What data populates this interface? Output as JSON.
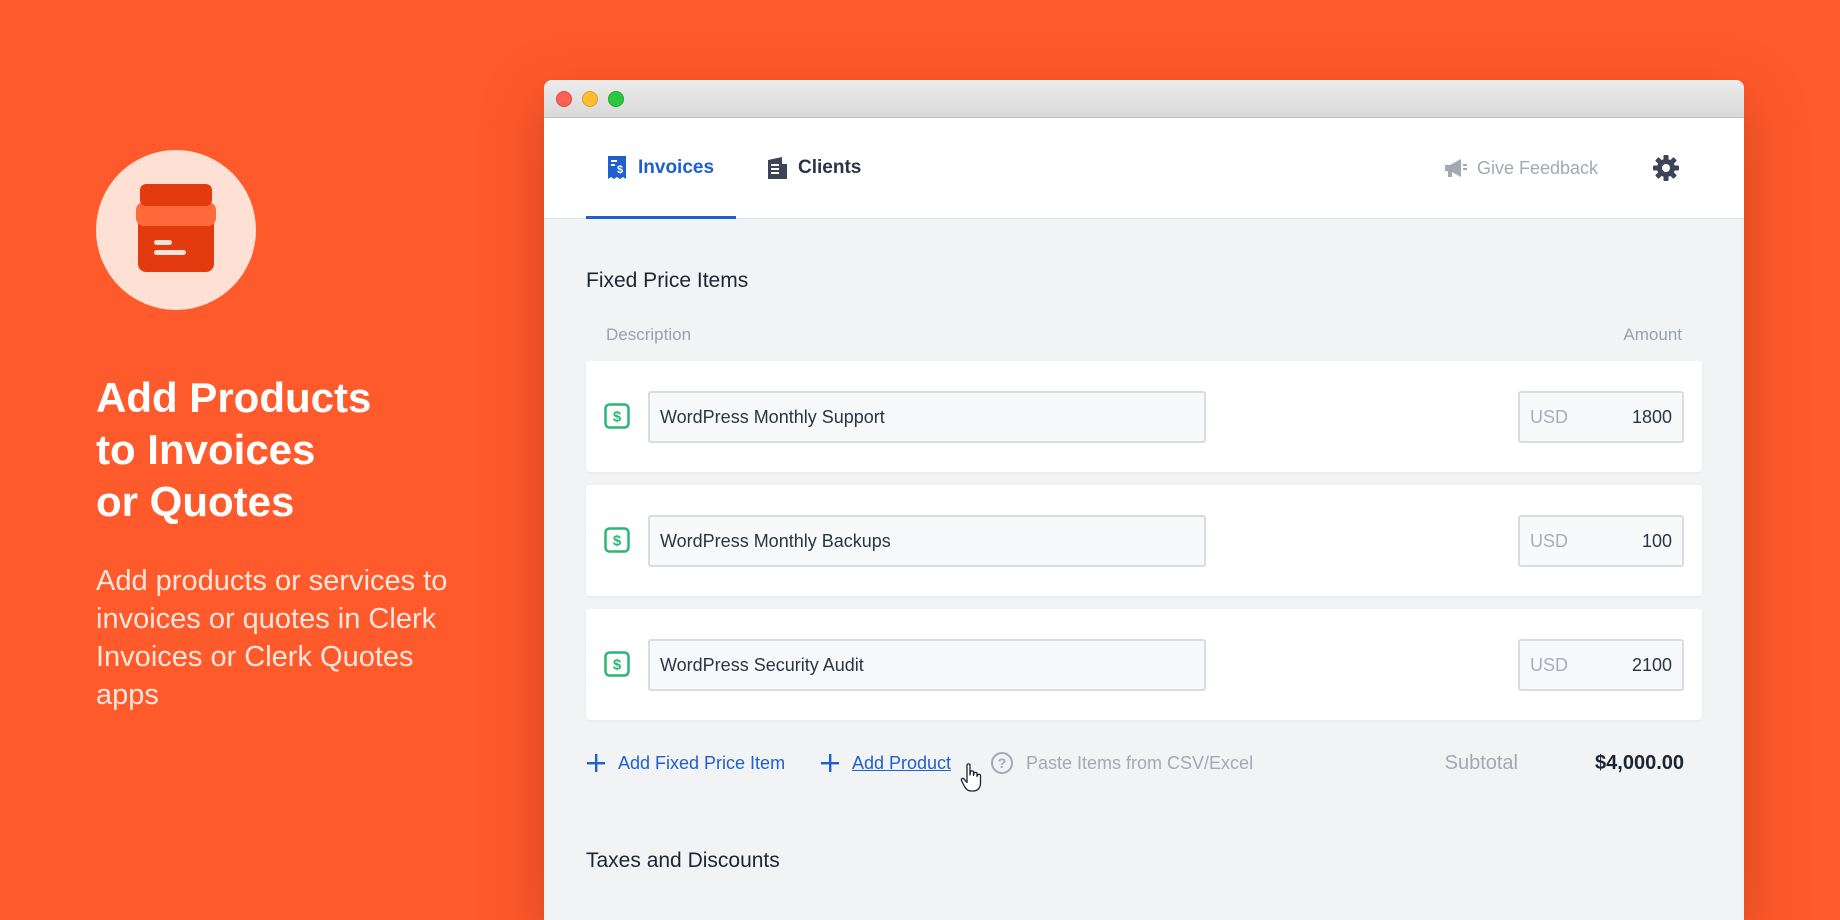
{
  "hero": {
    "title": "Add Products\nto Invoices\nor Quotes",
    "subtitle": "Add products or services to invoices or quotes in Clerk Invoices or Clerk Quotes apps",
    "icon": "archive-box-icon"
  },
  "colors": {
    "background": "#ff5a2c",
    "accent": "#1f5fcf",
    "money_icon": "#2bb673"
  },
  "nav": {
    "tabs": [
      {
        "label": "Invoices",
        "icon": "invoice-icon",
        "active": true
      },
      {
        "label": "Clients",
        "icon": "building-icon",
        "active": false
      }
    ],
    "feedback_label": "Give Feedback",
    "settings_icon": "gear-icon"
  },
  "fixed_items": {
    "title": "Fixed Price Items",
    "col_description": "Description",
    "col_amount": "Amount",
    "rows": [
      {
        "description": "WordPress Monthly Support",
        "currency": "USD",
        "amount": "1800"
      },
      {
        "description": "WordPress Monthly Backups",
        "currency": "USD",
        "amount": "100"
      },
      {
        "description": "WordPress Security Audit",
        "currency": "USD",
        "amount": "2100"
      }
    ],
    "actions": {
      "add_fixed": "Add Fixed Price Item",
      "add_product": "Add Product",
      "paste": "Paste Items from CSV/Excel"
    },
    "subtotal_label": "Subtotal",
    "subtotal_value": "$4,000.00"
  },
  "taxes": {
    "title": "Taxes and Discounts"
  }
}
